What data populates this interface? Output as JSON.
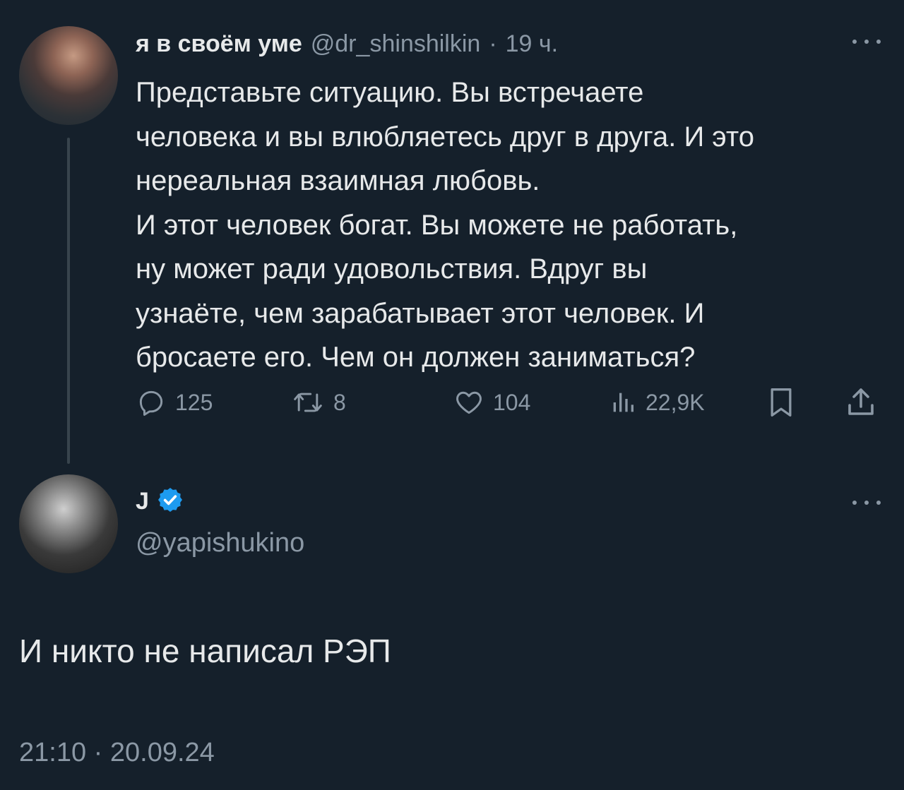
{
  "parent_tweet": {
    "display_name": "я в своём уме",
    "handle": "@dr_shinshilkin",
    "separator": "·",
    "time": "19 ч.",
    "text": "Представьте ситуацию. Вы встречаете\nчеловека и вы влюбляетесь друг в друга. И это\nнереальная взаимная любовь.\nИ этот человек богат. Вы можете не работать,\nну может ради удовольствия. Вдруг вы\nузнаёте, чем зарабатывает этот человек. И\nбросаете его. Чем он должен заниматься?",
    "actions": {
      "replies": "125",
      "retweets": "8",
      "likes": "104",
      "views": "22,9K"
    },
    "icons": [
      "reply-icon",
      "retweet-icon",
      "like-icon",
      "views-icon",
      "bookmark-icon",
      "share-icon",
      "more-icon"
    ]
  },
  "reply_tweet": {
    "display_name": "J",
    "verified": true,
    "verified_color": "#1d9bf0",
    "handle": "@yapishukino",
    "text": "И никто не написал РЭП",
    "timestamp": "21:10 · 20.09.24"
  },
  "colors": {
    "background": "#15202b",
    "text_primary": "#e7e9ea",
    "text_secondary": "#8b98a5",
    "thread_line": "#38444d"
  }
}
